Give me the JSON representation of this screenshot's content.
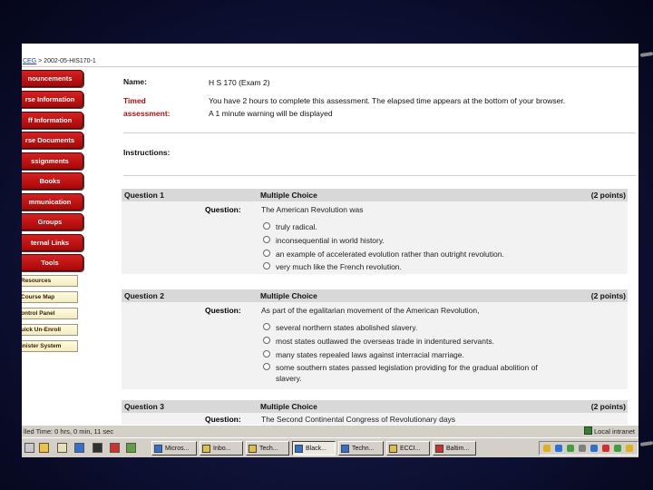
{
  "breadcrumb": {
    "course_link": "CEG",
    "separator": ">",
    "course_id": "2002-05-HIS170-1"
  },
  "sidebar": {
    "nav": [
      "nouncements",
      "rse Information",
      "ff Information",
      "rse Documents",
      "ssignments",
      "Books",
      "mmunication",
      "Groups",
      "ternal Links",
      "Tools"
    ],
    "tools": [
      "Resources",
      "Course Map",
      "ontrol Panel",
      "uick Un-Enroll",
      "inister System"
    ]
  },
  "assessment": {
    "name_label": "Name:",
    "name_value": "H S 170 (Exam 2)",
    "timed_label_1": "Timed",
    "timed_label_2": "assessment:",
    "timed_line_1": "You have 2 hours to complete this assessment. The elapsed time appears at the bottom of your browser.",
    "timed_line_2": "A 1 minute warning will be displayed",
    "instructions_label": "Instructions:"
  },
  "questions": [
    {
      "title": "Question 1",
      "type": "Multiple Choice",
      "points": "(2 points)",
      "question_label": "Question:",
      "text": "The American Revolution was",
      "options": [
        "truly radical.",
        "inconsequential in world history.",
        "an example of accelerated evolution rather than outright revolution.",
        "very much like the French revolution."
      ]
    },
    {
      "title": "Question 2",
      "type": "Multiple Choice",
      "points": "(2 points)",
      "question_label": "Question:",
      "text": "As part of the egalitarian movement of the American Revolution,",
      "options": [
        "several northern states abolished slavery.",
        "most states outlawed the overseas trade in indentured servants.",
        "many states repealed laws against interracial marriage.",
        "some southern states passed legislation providing for the gradual abolition of slavery."
      ]
    },
    {
      "title": "Question 3",
      "type": "Multiple Choice",
      "points": "(2 points)",
      "question_label": "Question:",
      "text": "The Second Continental Congress of Revolutionary days"
    }
  ],
  "statusbar": {
    "elapsed": "lled Time: 0 hrs, 0 min, 11 sec",
    "zone": "Local intranet"
  },
  "taskbar": {
    "tasks": [
      "Micros...",
      "Inbo...",
      "Tech...",
      "Black...",
      "Techn...",
      "ECCI...",
      "Baltim..."
    ]
  }
}
